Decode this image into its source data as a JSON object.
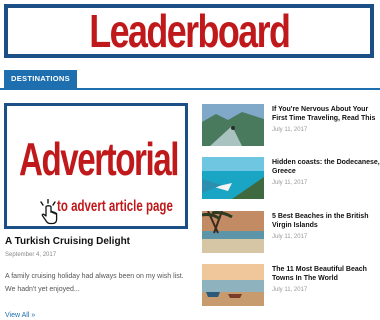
{
  "leaderboard": {
    "label": "Leaderboard"
  },
  "tabs": {
    "destinations": "DESTINATIONS"
  },
  "advert": {
    "title": "Advertorial",
    "cta": "to advert article page"
  },
  "feature": {
    "title": "A Turkish Cruising Delight",
    "date": "September 4, 2017",
    "excerpt": "A family cruising holiday had always been on my wish list. We hadn't yet enjoyed...",
    "view_all": "View All »"
  },
  "articles": [
    {
      "title": "If You're Nervous About Your First Time Traveling, Read This",
      "date": "July 11, 2017"
    },
    {
      "title": "Hidden coasts: the Dodecanese, Greece",
      "date": "July 11, 2017"
    },
    {
      "title": "5 Best Beaches in the British Virgin Islands",
      "date": "July 11, 2017"
    },
    {
      "title": "The 11 Most Beautiful Beach Towns In The World",
      "date": "July 11, 2017"
    }
  ],
  "colors": {
    "accent": "#1d6fb0",
    "ad_red": "#c0191b",
    "ad_border": "#1c4f86"
  }
}
